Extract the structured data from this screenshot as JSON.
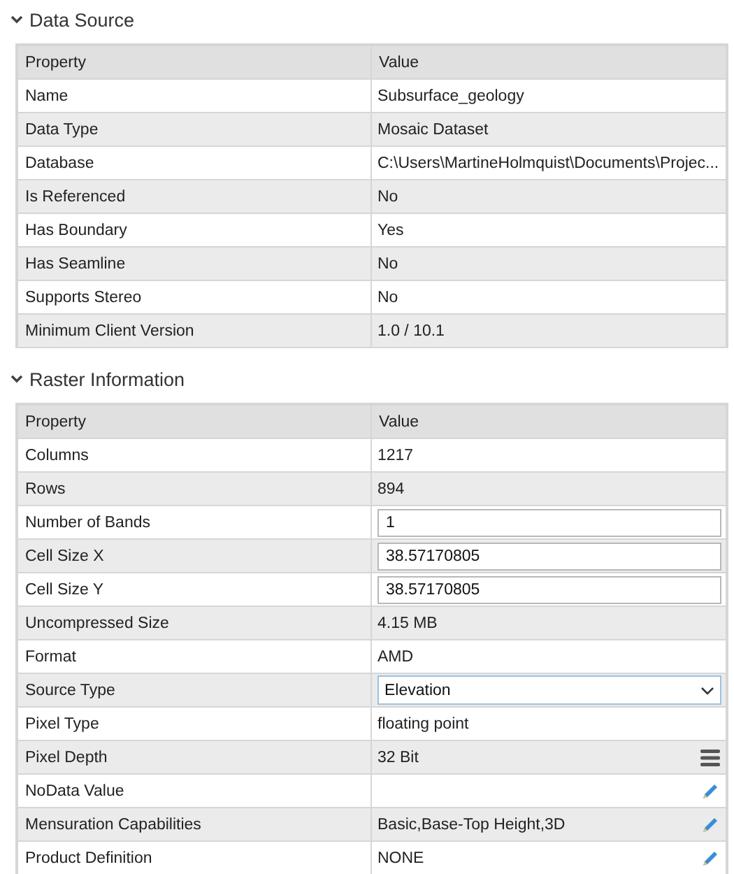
{
  "sections": [
    {
      "title": "Data Source",
      "expanded": true,
      "columns": [
        "Property",
        "Value"
      ],
      "rows": [
        {
          "kind": "text",
          "property": "Name",
          "value": "Subsurface_geology"
        },
        {
          "kind": "text",
          "property": "Data Type",
          "value": "Mosaic Dataset"
        },
        {
          "kind": "text",
          "property": "Database",
          "value": "C:\\Users\\MartineHolmquist\\Documents\\Projec..."
        },
        {
          "kind": "text",
          "property": "Is Referenced",
          "value": "No"
        },
        {
          "kind": "text",
          "property": "Has Boundary",
          "value": "Yes"
        },
        {
          "kind": "text",
          "property": "Has Seamline",
          "value": "No"
        },
        {
          "kind": "text",
          "property": "Supports Stereo",
          "value": "No"
        },
        {
          "kind": "text",
          "property": "Minimum Client Version",
          "value": "1.0 / 10.1"
        }
      ]
    },
    {
      "title": "Raster Information",
      "expanded": true,
      "columns": [
        "Property",
        "Value"
      ],
      "rows": [
        {
          "kind": "text",
          "property": "Columns",
          "value": "1217"
        },
        {
          "kind": "text",
          "property": "Rows",
          "value": "894"
        },
        {
          "kind": "input",
          "property": "Number of Bands",
          "value": "1"
        },
        {
          "kind": "input",
          "property": "Cell Size X",
          "value": "38.57170805"
        },
        {
          "kind": "input",
          "property": "Cell Size Y",
          "value": "38.57170805"
        },
        {
          "kind": "text",
          "property": "Uncompressed Size",
          "value": "4.15 MB"
        },
        {
          "kind": "text",
          "property": "Format",
          "value": "AMD"
        },
        {
          "kind": "dropdown",
          "property": "Source Type",
          "value": "Elevation"
        },
        {
          "kind": "text",
          "property": "Pixel Type",
          "value": "floating point"
        },
        {
          "kind": "menu",
          "property": "Pixel Depth",
          "value": "32 Bit"
        },
        {
          "kind": "edit",
          "property": "NoData Value"
        },
        {
          "kind": "edit",
          "property": "Mensuration Capabilities",
          "value": "Basic,Base-Top Height,3D"
        },
        {
          "kind": "edit",
          "property": "Product Definition",
          "value": "NONE"
        }
      ]
    }
  ]
}
